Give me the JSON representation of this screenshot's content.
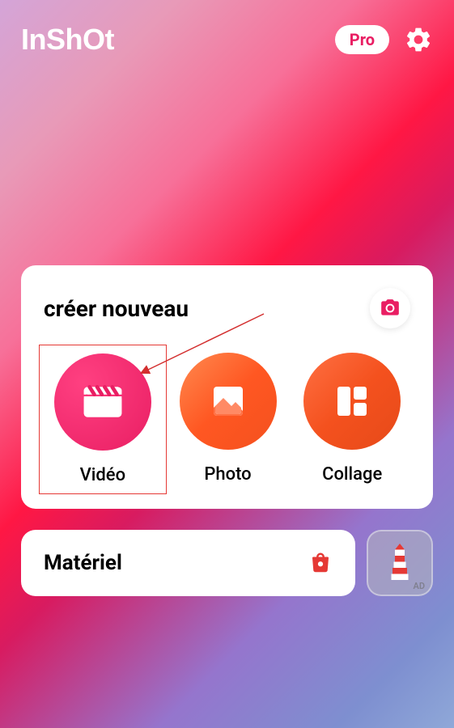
{
  "header": {
    "logo": "InShOt",
    "pro_label": "Pro"
  },
  "create": {
    "title": "créer nouveau",
    "options": {
      "video": {
        "label": "Vidéo"
      },
      "photo": {
        "label": "Photo"
      },
      "collage": {
        "label": "Collage"
      }
    }
  },
  "material": {
    "title": "Matériel"
  },
  "ad": {
    "label": "AD"
  },
  "icons": {
    "settings": "gear-icon",
    "camera": "camera-icon",
    "video": "clapperboard-icon",
    "photo": "image-icon",
    "collage": "grid-icon",
    "bag": "shopping-bag-icon",
    "lighthouse": "lighthouse-icon"
  },
  "colors": {
    "accent_pink": "#e91e63",
    "accent_orange": "#ff5722",
    "highlight_border": "#e53935",
    "arrow": "#d32f2f"
  }
}
